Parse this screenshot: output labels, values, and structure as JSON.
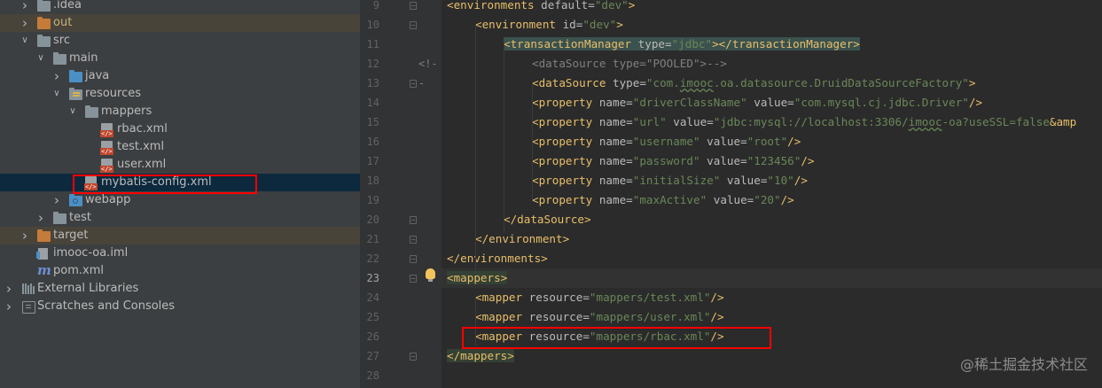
{
  "project_tree": {
    "items": [
      {
        "label": ".idea",
        "depth": 1,
        "expanded": false,
        "icon": "folder-icon",
        "color": "grey"
      },
      {
        "label": "out",
        "depth": 1,
        "expanded": false,
        "icon": "folder-icon",
        "color": "orange",
        "excluded": true
      },
      {
        "label": "src",
        "depth": 1,
        "expanded": true,
        "icon": "folder-icon",
        "color": "grey"
      },
      {
        "label": "main",
        "depth": 2,
        "expanded": true,
        "icon": "folder-icon",
        "color": "grey"
      },
      {
        "label": "java",
        "depth": 3,
        "expanded": false,
        "icon": "source-folder-icon",
        "color": "blue"
      },
      {
        "label": "resources",
        "depth": 3,
        "expanded": true,
        "icon": "resources-folder-icon",
        "color": "grey"
      },
      {
        "label": "mappers",
        "depth": 4,
        "expanded": true,
        "icon": "folder-icon",
        "color": "grey"
      },
      {
        "label": "rbac.xml",
        "depth": 5,
        "icon": "xml-file-icon"
      },
      {
        "label": "test.xml",
        "depth": 5,
        "icon": "xml-file-icon"
      },
      {
        "label": "user.xml",
        "depth": 5,
        "icon": "xml-file-icon"
      },
      {
        "label": "mybatis-config.xml",
        "depth": 4,
        "icon": "xml-file-icon",
        "selected": true
      },
      {
        "label": "webapp",
        "depth": 3,
        "expanded": false,
        "icon": "web-folder-icon",
        "color": "blue"
      },
      {
        "label": "test",
        "depth": 2,
        "expanded": false,
        "icon": "folder-icon",
        "color": "grey"
      },
      {
        "label": "target",
        "depth": 1,
        "expanded": false,
        "icon": "folder-icon",
        "color": "orange",
        "excluded": true
      },
      {
        "label": "imooc-oa.iml",
        "depth": 1,
        "icon": "iml-file-icon"
      },
      {
        "label": "pom.xml",
        "depth": 1,
        "icon": "maven-icon"
      },
      {
        "label": "External Libraries",
        "depth": 0,
        "expanded": false,
        "icon": "libraries-icon"
      },
      {
        "label": "Scratches and Consoles",
        "depth": 0,
        "expanded": false,
        "icon": "scratches-icon"
      }
    ]
  },
  "editor": {
    "current_line": 23,
    "lines": [
      {
        "num": "9",
        "indent": 0,
        "tokens": [
          [
            "t",
            "<environments "
          ],
          [
            "a",
            "default="
          ],
          [
            "v",
            "\"dev\""
          ],
          [
            "t",
            ">"
          ]
        ]
      },
      {
        "num": "10",
        "indent": 1,
        "tokens": [
          [
            "t",
            "<environment "
          ],
          [
            "a",
            "id="
          ],
          [
            "v",
            "\"dev\""
          ],
          [
            "t",
            ">"
          ]
        ]
      },
      {
        "num": "11",
        "indent": 2,
        "tokens": [
          [
            "t hl",
            "<transactionManager "
          ],
          [
            "a hl",
            "type="
          ],
          [
            "v hl",
            "\"jdbc\""
          ],
          [
            "t hl",
            "></transactionManager>"
          ]
        ]
      },
      {
        "num": "12",
        "indent": 3,
        "prefix": "<!--",
        "tokens": [
          [
            "c",
            "<dataSource type=\"POOLED\">-->"
          ]
        ]
      },
      {
        "num": "13",
        "indent": 3,
        "tokens": [
          [
            "t",
            "<dataSource "
          ],
          [
            "a",
            "type="
          ],
          [
            "v",
            "\"com."
          ],
          [
            "v ul",
            "imooc"
          ],
          [
            "v",
            ".oa.datasource.DruidDataSourceFactory\""
          ],
          [
            "t",
            ">"
          ]
        ]
      },
      {
        "num": "14",
        "indent": 3,
        "tokens": [
          [
            "t",
            "<property "
          ],
          [
            "a",
            "name="
          ],
          [
            "v",
            "\"driverClassName\" "
          ],
          [
            "a",
            "value="
          ],
          [
            "v",
            "\"com.mysql.cj.jdbc.Driver\""
          ],
          [
            "t",
            "/>"
          ]
        ]
      },
      {
        "num": "15",
        "indent": 3,
        "tokens": [
          [
            "t",
            "<property "
          ],
          [
            "a",
            "name="
          ],
          [
            "v",
            "\"url\" "
          ],
          [
            "a",
            "value="
          ],
          [
            "v",
            "\"jdbc:mysql://localhost:3306/"
          ],
          [
            "v ul",
            "imooc"
          ],
          [
            "v",
            "-oa?useSSL=false"
          ],
          [
            "t",
            "&amp"
          ]
        ]
      },
      {
        "num": "16",
        "indent": 3,
        "tokens": [
          [
            "t",
            "<property "
          ],
          [
            "a",
            "name="
          ],
          [
            "v",
            "\"username\" "
          ],
          [
            "a",
            "value="
          ],
          [
            "v",
            "\"root\""
          ],
          [
            "t",
            "/>"
          ]
        ]
      },
      {
        "num": "17",
        "indent": 3,
        "tokens": [
          [
            "t",
            "<property "
          ],
          [
            "a",
            "name="
          ],
          [
            "v",
            "\"password\" "
          ],
          [
            "a",
            "value="
          ],
          [
            "v",
            "\"123456\""
          ],
          [
            "t",
            "/>"
          ]
        ]
      },
      {
        "num": "18",
        "indent": 3,
        "tokens": [
          [
            "t",
            "<property "
          ],
          [
            "a",
            "name="
          ],
          [
            "v",
            "\"initialSize\" "
          ],
          [
            "a",
            "value="
          ],
          [
            "v",
            "\"10\""
          ],
          [
            "t",
            "/>"
          ]
        ]
      },
      {
        "num": "19",
        "indent": 3,
        "tokens": [
          [
            "t",
            "<property "
          ],
          [
            "a",
            "name="
          ],
          [
            "v",
            "\"maxActive\" "
          ],
          [
            "a",
            "value="
          ],
          [
            "v",
            "\"20\""
          ],
          [
            "t",
            "/>"
          ]
        ]
      },
      {
        "num": "20",
        "indent": 2,
        "tokens": [
          [
            "t",
            "</dataSource>"
          ]
        ]
      },
      {
        "num": "21",
        "indent": 1,
        "tokens": [
          [
            "t",
            "</environment>"
          ]
        ]
      },
      {
        "num": "22",
        "indent": 0,
        "tokens": [
          [
            "t",
            "</environments>"
          ]
        ]
      },
      {
        "num": "23",
        "indent": 0,
        "tokens": [
          [
            "t hl2",
            "<mappers>"
          ]
        ]
      },
      {
        "num": "24",
        "indent": 1,
        "tokens": [
          [
            "t",
            "<mapper "
          ],
          [
            "a",
            "resource="
          ],
          [
            "v",
            "\"mappers/test.xml\""
          ],
          [
            "t",
            "/>"
          ]
        ]
      },
      {
        "num": "25",
        "indent": 1,
        "tokens": [
          [
            "t",
            "<mapper "
          ],
          [
            "a",
            "resource="
          ],
          [
            "v",
            "\"mappers/user.xml\""
          ],
          [
            "t",
            "/>"
          ]
        ]
      },
      {
        "num": "26",
        "indent": 1,
        "tokens": [
          [
            "t",
            "<mapper "
          ],
          [
            "a",
            "resource="
          ],
          [
            "v",
            "\"mappers/rbac.xml\""
          ],
          [
            "t",
            "/>"
          ]
        ]
      },
      {
        "num": "27",
        "indent": 0,
        "tokens": [
          [
            "t hl2",
            "</mappers>"
          ]
        ]
      },
      {
        "num": "28",
        "indent": 0,
        "tokens": []
      }
    ]
  },
  "watermark": "@稀土掘金技术社区",
  "colors": {
    "tree_bg": "#3c3f41",
    "editor_bg": "#2b2b2b",
    "gutter_bg": "#313335",
    "tag": "#e8bf6a",
    "attribute": "#bababa",
    "string": "#6a8759",
    "comment": "#808080",
    "annotation_box": "#ff0000"
  }
}
